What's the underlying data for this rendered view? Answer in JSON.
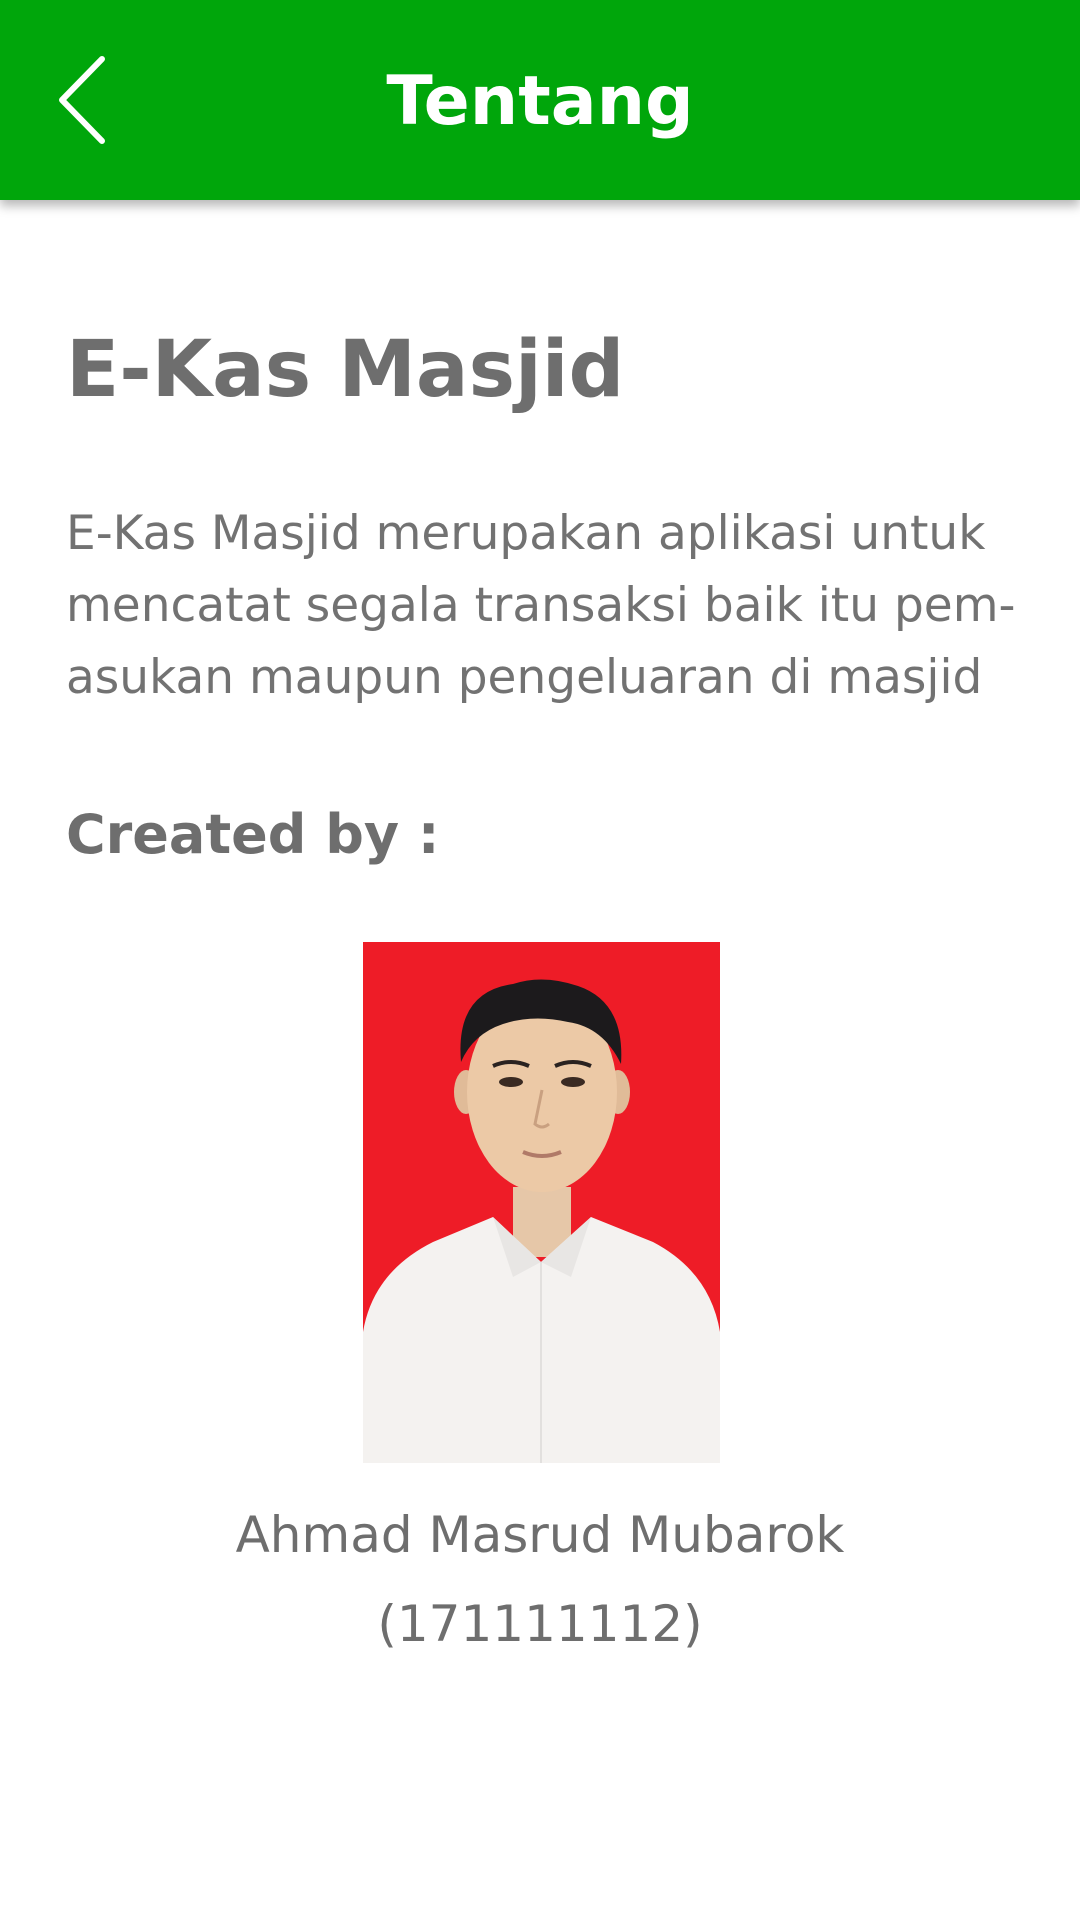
{
  "appbar": {
    "title": "Tentang",
    "back_icon": "chevron-left-icon",
    "color": "#00a60b"
  },
  "about": {
    "app_name": "E-Kas Masjid",
    "description_lines": [
      "E-Kas Masjid merupakan aplikasi untuk",
      "mencatat segala transaksi baik itu pem-",
      "asukan maupun pengeluaran di masjid"
    ],
    "created_by_label": "Created by :"
  },
  "author": {
    "name": "Ahmad Masrud Mubarok",
    "id": "(171111112)",
    "photo_background": "#ee1c27"
  }
}
